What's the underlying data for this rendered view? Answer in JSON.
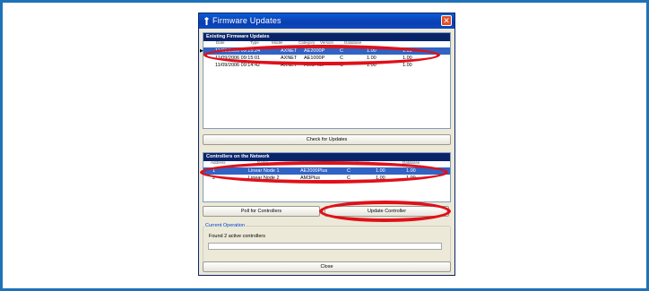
{
  "window": {
    "title": "Firmware Updates",
    "close_glyph": "✕",
    "icon": "wrench-icon"
  },
  "existing": {
    "header": "Existing Firmware Updates",
    "columns": [
      "Date",
      "Type",
      "Model",
      "Category",
      "Version",
      "Database"
    ],
    "rows": [
      [
        "11/09/2006 09:15:24",
        "AXNET",
        "AE2000P",
        "C",
        "1.00",
        "1.00"
      ],
      [
        "11/09/2006 09:15:01",
        "AXNET",
        "AE1000P",
        "C",
        "1.00",
        "1.00"
      ],
      [
        "11/09/2006 09:14:42",
        "AXNET",
        "AM3Plus",
        "C",
        "1.00",
        "1.00"
      ]
    ],
    "selected_index": 0
  },
  "check_updates_label": "Check for Updates",
  "controllers": {
    "header": "Controllers on the Network",
    "columns": [
      "Address",
      "Name",
      "Model",
      "Category",
      "Version",
      "Database"
    ],
    "rows": [
      [
        "1",
        "Linear Node 1",
        "AE2000Plus",
        "C",
        "1.00",
        "1.00"
      ],
      [
        "2",
        "Linear Node 2",
        "AM3Plus",
        "C",
        "1.00",
        "1.00"
      ]
    ],
    "selected_index": 0
  },
  "poll_label": "Poll for Controllers",
  "update_label": "Update Controller",
  "operation": {
    "legend": "Current Operation",
    "status": "Found 2 active controllers",
    "progress": 0
  },
  "close_label": "Close",
  "colors": {
    "frame": "#1e73b8",
    "highlight_ellipse": "#e01019",
    "selection": "#3163c5"
  }
}
